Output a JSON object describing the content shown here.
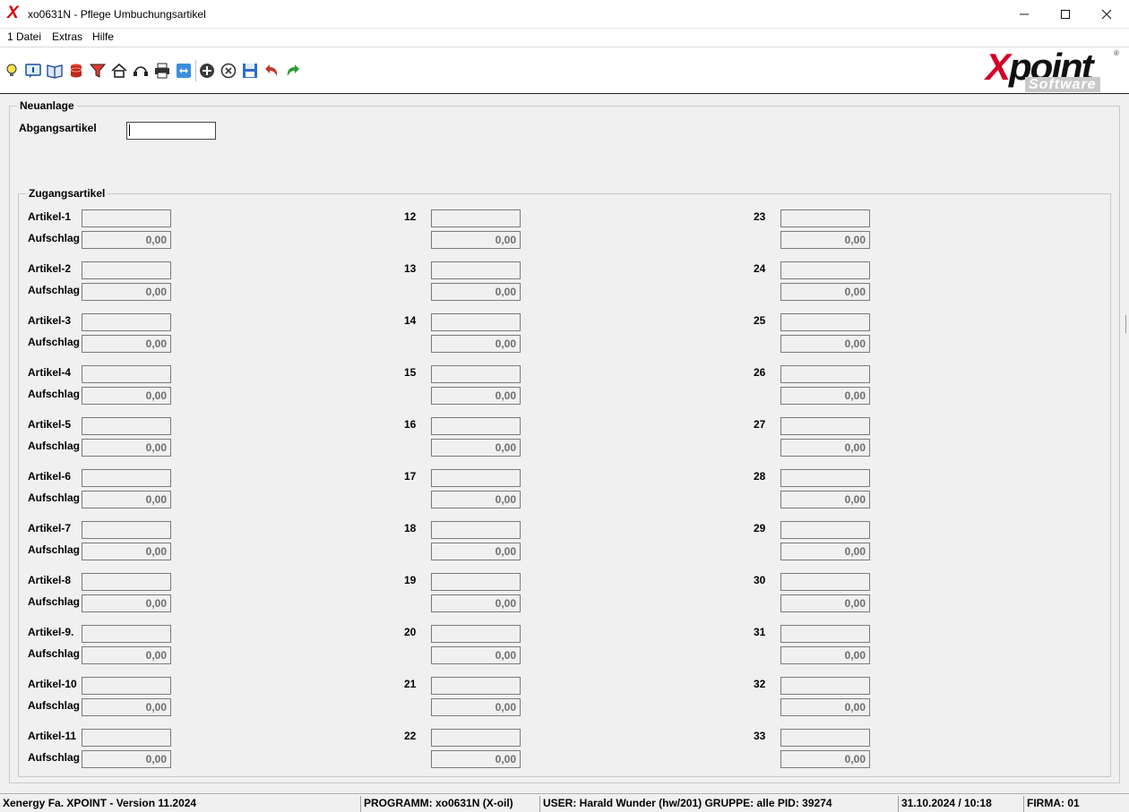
{
  "window": {
    "title": "xo0631N - Pflege Umbuchungsartikel",
    "app_icon": "X"
  },
  "menu": [
    "1 Datei",
    "Extras",
    "Hilfe"
  ],
  "toolbar_icons": [
    "lightbulb-icon",
    "info-icon",
    "book-icon",
    "database-icon",
    "filter-icon",
    "home-icon",
    "headset-icon",
    "printer-icon",
    "teamviewer-icon",
    "add-icon",
    "delete-icon",
    "save-icon",
    "undo-icon",
    "redo-icon"
  ],
  "logo": {
    "main_x": "X",
    "main_rest": "point",
    "sub": "Software",
    "reg": "®"
  },
  "neuanlage": {
    "title": "Neuanlage",
    "abgang_label": "Abgangsartikel",
    "abgang_value": ""
  },
  "zugang": {
    "title": "Zugangsartikel",
    "surcharge_label": "Aufschlag",
    "columns": [
      {
        "rows": [
          {
            "label": "Artikel-1",
            "value": "",
            "aufschlag": "0,00"
          },
          {
            "label": "Artikel-2",
            "value": "",
            "aufschlag": "0,00"
          },
          {
            "label": "Artikel-3",
            "value": "",
            "aufschlag": "0,00"
          },
          {
            "label": "Artikel-4",
            "value": "",
            "aufschlag": "0,00"
          },
          {
            "label": "Artikel-5",
            "value": "",
            "aufschlag": "0,00"
          },
          {
            "label": "Artikel-6",
            "value": "",
            "aufschlag": "0,00"
          },
          {
            "label": "Artikel-7",
            "value": "",
            "aufschlag": "0,00"
          },
          {
            "label": "Artikel-8",
            "value": "",
            "aufschlag": "0,00"
          },
          {
            "label": "Artikel-9.",
            "value": "",
            "aufschlag": "0,00"
          },
          {
            "label": "Artikel-10",
            "value": "",
            "aufschlag": "0,00"
          },
          {
            "label": "Artikel-11",
            "value": "",
            "aufschlag": "0,00"
          }
        ]
      },
      {
        "rows": [
          {
            "label": "12",
            "value": "",
            "aufschlag": "0,00"
          },
          {
            "label": "13",
            "value": "",
            "aufschlag": "0,00"
          },
          {
            "label": "14",
            "value": "",
            "aufschlag": "0,00"
          },
          {
            "label": "15",
            "value": "",
            "aufschlag": "0,00"
          },
          {
            "label": "16",
            "value": "",
            "aufschlag": "0,00"
          },
          {
            "label": "17",
            "value": "",
            "aufschlag": "0,00"
          },
          {
            "label": "18",
            "value": "",
            "aufschlag": "0,00"
          },
          {
            "label": "19",
            "value": "",
            "aufschlag": "0,00"
          },
          {
            "label": "20",
            "value": "",
            "aufschlag": "0,00"
          },
          {
            "label": "21",
            "value": "",
            "aufschlag": "0,00"
          },
          {
            "label": "22",
            "value": "",
            "aufschlag": "0,00"
          }
        ]
      },
      {
        "rows": [
          {
            "label": "23",
            "value": "",
            "aufschlag": "0,00"
          },
          {
            "label": "24",
            "value": "",
            "aufschlag": "0,00"
          },
          {
            "label": "25",
            "value": "",
            "aufschlag": "0,00"
          },
          {
            "label": "26",
            "value": "",
            "aufschlag": "0,00"
          },
          {
            "label": "27",
            "value": "",
            "aufschlag": "0,00"
          },
          {
            "label": "28",
            "value": "",
            "aufschlag": "0,00"
          },
          {
            "label": "29",
            "value": "",
            "aufschlag": "0,00"
          },
          {
            "label": "30",
            "value": "",
            "aufschlag": "0,00"
          },
          {
            "label": "31",
            "value": "",
            "aufschlag": "0,00"
          },
          {
            "label": "32",
            "value": "",
            "aufschlag": "0,00"
          },
          {
            "label": "33",
            "value": "",
            "aufschlag": "0,00"
          }
        ]
      }
    ]
  },
  "status": [
    "Xenergy Fa. XPOINT - Version 11.2024",
    "PROGRAMM: xo0631N (X-oil)",
    "USER: Harald Wunder (hw/201)  GRUPPE: alle  PID: 39274",
    "31.10.2024 / 10:18",
    "FIRMA: 01"
  ],
  "colors": {
    "logo_red": "#d4002a",
    "undo_red": "#c0392b",
    "redo_green": "#2e9a3a"
  }
}
